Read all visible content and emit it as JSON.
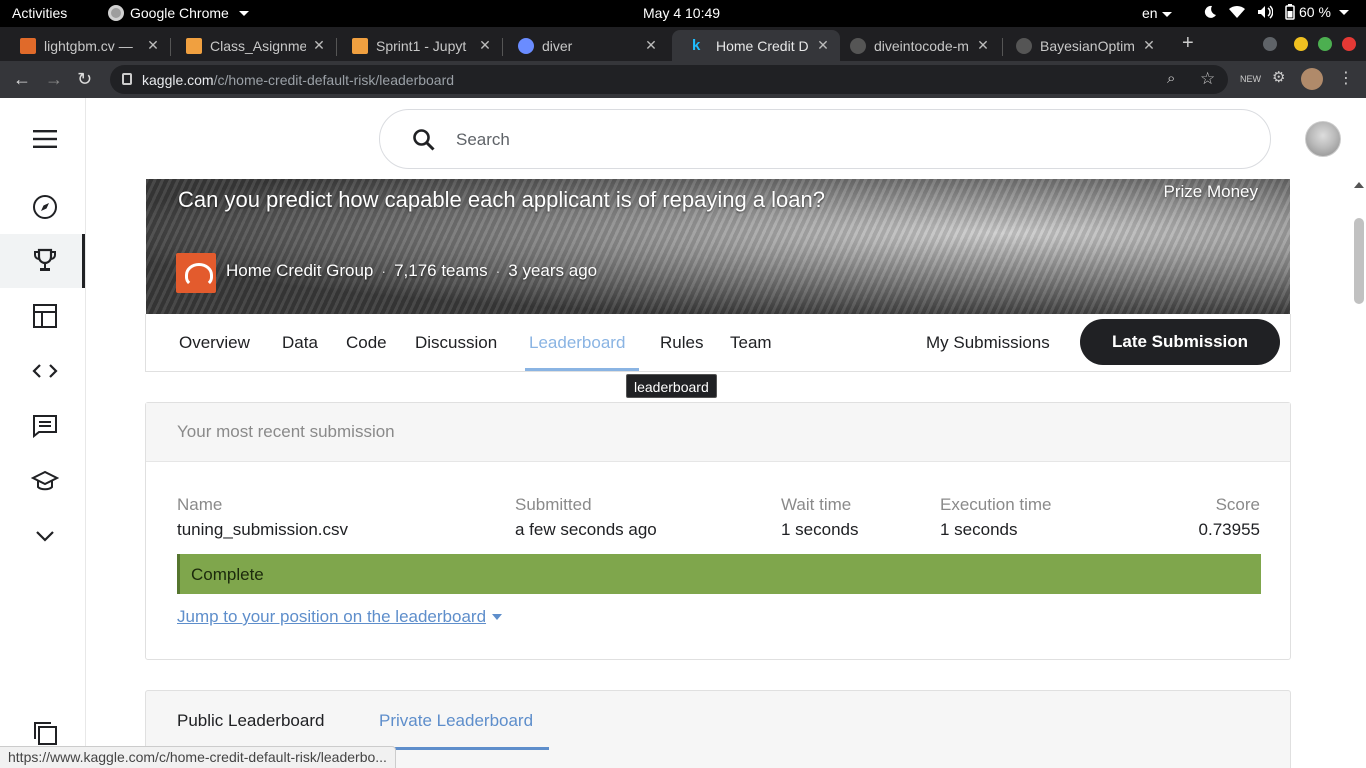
{
  "system_bar": {
    "activities": "Activities",
    "app_name": "Google Chrome",
    "clock": "May 4  10:49",
    "language": "en",
    "battery": "60 %"
  },
  "tabs": [
    {
      "title": "lightgbm.cv —",
      "favicon_color": "#e06a2a"
    },
    {
      "title": "Class_Asignme",
      "favicon_color": "#f0a040"
    },
    {
      "title": "Sprint1 - Jupyt",
      "favicon_color": "#f0a040"
    },
    {
      "title": "diver",
      "favicon_color": "#6a8cff"
    },
    {
      "title": "Home Credit D",
      "favicon_color": "#20beff"
    },
    {
      "title": "diveintocode-m",
      "favicon_color": "#888888"
    },
    {
      "title": "BayesianOptim",
      "favicon_color": "#888888"
    }
  ],
  "browser": {
    "url_host": "kaggle.com",
    "url_path": "/c/home-credit-default-risk/leaderboard",
    "new_tab_label": "+"
  },
  "search": {
    "placeholder": "Search"
  },
  "hero": {
    "subtitle": "Can you predict how capable each applicant is of repaying a loan?",
    "prize": "Prize Money",
    "host": "Home Credit Group",
    "teams": "7,176 teams",
    "age": "3 years ago",
    "separator": "·"
  },
  "competition_tabs": [
    "Overview",
    "Data",
    "Code",
    "Discussion",
    "Leaderboard",
    "Rules",
    "Team"
  ],
  "my_submissions": "My Submissions",
  "late_submission": "Late Submission",
  "tooltip": "leaderboard",
  "recent": {
    "heading": "Your most recent submission",
    "headers": {
      "name": "Name",
      "submitted": "Submitted",
      "wait": "Wait time",
      "exec": "Execution time",
      "score": "Score"
    },
    "values": {
      "name": "tuning_submission.csv",
      "submitted": "a few seconds ago",
      "wait": "1 seconds",
      "exec": "1 seconds",
      "score": "0.73955"
    },
    "status": "Complete",
    "status_color": "#7fa64c",
    "jump_link": "Jump to your position on the leaderboard"
  },
  "leaderboard_tabs": {
    "public": "Public Leaderboard",
    "private": "Private Leaderboard"
  },
  "status_url": "https://www.kaggle.com/c/home-credit-default-risk/leaderbo..."
}
